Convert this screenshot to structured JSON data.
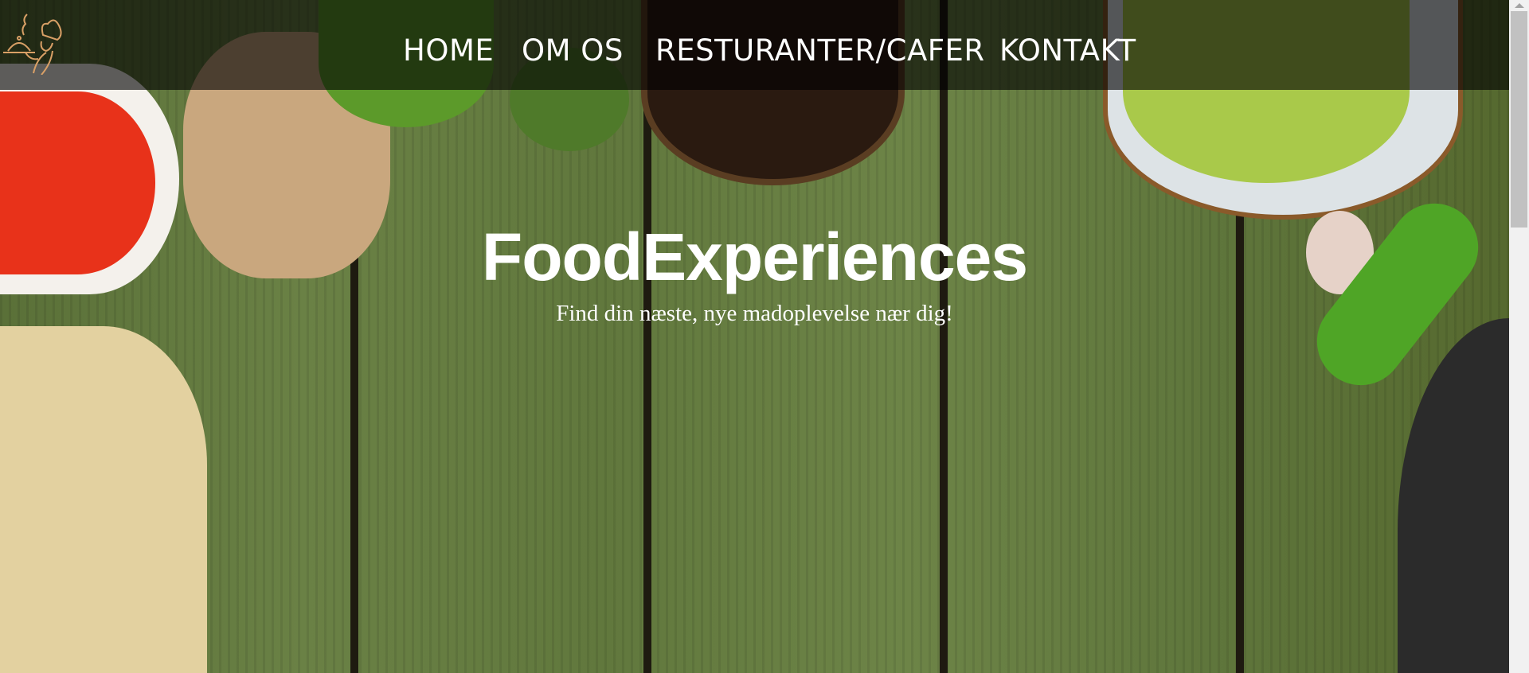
{
  "nav": {
    "items": [
      {
        "label": "HOME"
      },
      {
        "label": "OM OS"
      },
      {
        "label": "RESTURANTER/CAFER"
      },
      {
        "label": "KONTAKT"
      }
    ]
  },
  "hero": {
    "title": "FoodExperiences",
    "subtitle": "Find din næste, nye madoplevelse nær dig!"
  },
  "colors": {
    "nav_bg": "#000000",
    "logo": "#d9a066",
    "text": "#ffffff"
  }
}
